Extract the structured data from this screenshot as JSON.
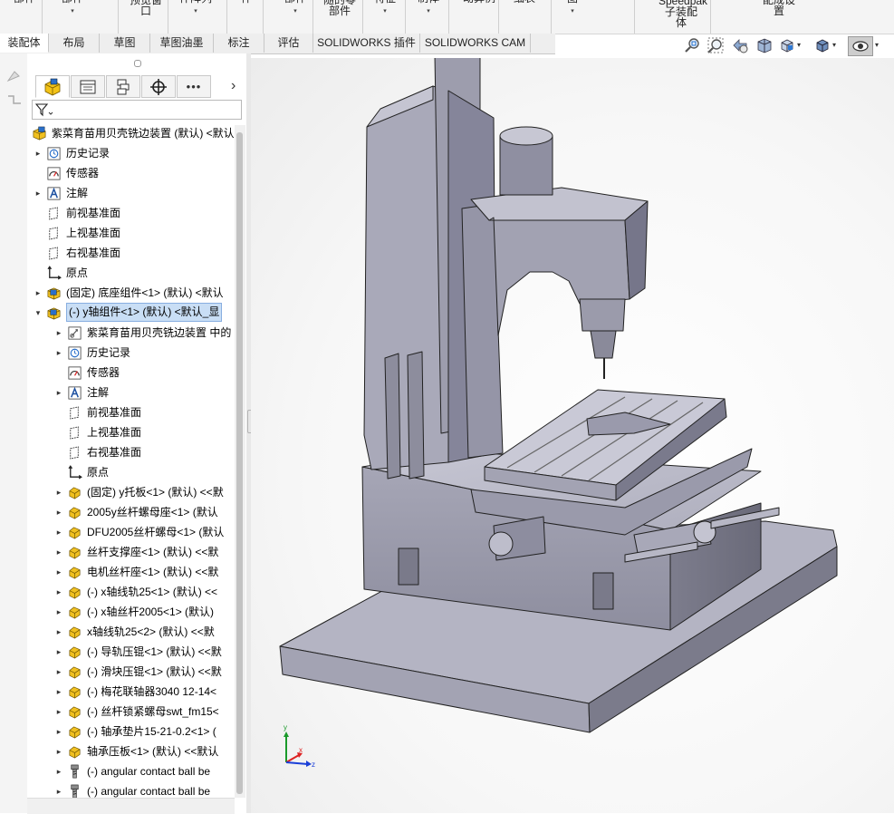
{
  "ribbon": {
    "buttons": [
      {
        "id": "b0",
        "lines": [
          "部件"
        ],
        "has_arrow": false
      },
      {
        "id": "b1",
        "lines": [
          "部件"
        ],
        "has_arrow": true
      },
      {
        "id": "b2",
        "lines": [
          "预览窗",
          "口"
        ],
        "has_arrow": false
      },
      {
        "id": "b3",
        "lines": [
          "件阵列"
        ],
        "has_arrow": true
      },
      {
        "id": "b4",
        "lines": [
          "件"
        ],
        "has_arrow": false
      },
      {
        "id": "b5",
        "lines": [
          "部件"
        ],
        "has_arrow": true
      },
      {
        "id": "b6",
        "lines": [
          "随的零",
          "部件"
        ],
        "has_arrow": false
      },
      {
        "id": "b7",
        "lines": [
          "特征"
        ],
        "has_arrow": true
      },
      {
        "id": "b8",
        "lines": [
          "制体"
        ],
        "has_arrow": true
      },
      {
        "id": "b9",
        "lines": [
          "动算例"
        ],
        "has_arrow": false
      },
      {
        "id": "b10",
        "lines": [
          "细表"
        ],
        "has_arrow": false
      },
      {
        "id": "b11",
        "lines": [
          "图"
        ],
        "has_arrow": true
      },
      {
        "id": "b12",
        "lines": [
          "Speedpak",
          "子装配",
          "体"
        ],
        "has_arrow": false
      },
      {
        "id": "b13",
        "lines": [
          "配成设",
          "置"
        ],
        "has_arrow": false
      }
    ]
  },
  "tabs": [
    "装配体",
    "布局",
    "草图",
    "草图油墨",
    "标注",
    "评估",
    "SOLIDWORKS 插件",
    "SOLIDWORKS CAM"
  ],
  "active_tab": "装配体",
  "view_toolbar": {
    "icons": [
      "zoom-to-fit-icon",
      "zoom-area-icon",
      "previous-view-icon",
      "section-view-icon",
      "view-orientation-icon",
      "display-style-icon",
      "hide-show-items-icon"
    ]
  },
  "feature_tree": {
    "panel_tabs": [
      "feature-manager-tab",
      "property-manager-tab",
      "configuration-manager-tab",
      "dimxpert-manager-tab",
      "more-tabs"
    ],
    "filter_icon": "filter-icon",
    "collapse_arrow": "›",
    "rows": [
      {
        "level": 0,
        "expander": "",
        "icon": "assembly-icon",
        "label": "紫菜育苗用贝壳铣边装置 (默认) <默认"
      },
      {
        "level": 1,
        "expander": "▸",
        "icon": "history-icon",
        "label": "历史记录"
      },
      {
        "level": 1,
        "expander": "",
        "icon": "sensor-icon",
        "label": "传感器"
      },
      {
        "level": 1,
        "expander": "▸",
        "icon": "annotation-icon",
        "label": "注解"
      },
      {
        "level": 1,
        "expander": "",
        "icon": "plane-icon",
        "label": "前视基准面"
      },
      {
        "level": 1,
        "expander": "",
        "icon": "plane-icon",
        "label": "上视基准面"
      },
      {
        "level": 1,
        "expander": "",
        "icon": "plane-icon",
        "label": "右视基准面"
      },
      {
        "level": 1,
        "expander": "",
        "icon": "origin-icon",
        "label": "原点"
      },
      {
        "level": 1,
        "expander": "▸",
        "icon": "subassembly-icon",
        "label": "(固定) 底座组件<1> (默认) <默认"
      },
      {
        "level": 1,
        "expander": "▾",
        "icon": "subassembly-icon",
        "label": "(-) y轴组件<1> (默认) <默认_显",
        "selected": true
      },
      {
        "level": 2,
        "expander": "▸",
        "icon": "reference-icon",
        "label": "紫菜育苗用贝壳铣边装置 中的"
      },
      {
        "level": 2,
        "expander": "▸",
        "icon": "history-icon",
        "label": "历史记录"
      },
      {
        "level": 2,
        "expander": "",
        "icon": "sensor-icon",
        "label": "传感器"
      },
      {
        "level": 2,
        "expander": "▸",
        "icon": "annotation-icon",
        "label": "注解"
      },
      {
        "level": 2,
        "expander": "",
        "icon": "plane-icon",
        "label": "前视基准面"
      },
      {
        "level": 2,
        "expander": "",
        "icon": "plane-icon",
        "label": "上视基准面"
      },
      {
        "level": 2,
        "expander": "",
        "icon": "plane-icon",
        "label": "右视基准面"
      },
      {
        "level": 2,
        "expander": "",
        "icon": "origin-icon",
        "label": "原点"
      },
      {
        "level": 2,
        "expander": "▸",
        "icon": "part-icon",
        "label": "(固定) y托板<1> (默认) <<默"
      },
      {
        "level": 2,
        "expander": "▸",
        "icon": "part-icon",
        "label": "2005y丝杆螺母座<1> (默认"
      },
      {
        "level": 2,
        "expander": "▸",
        "icon": "part-icon",
        "label": "DFU2005丝杆螺母<1> (默认"
      },
      {
        "level": 2,
        "expander": "▸",
        "icon": "part-icon",
        "label": "丝杆支撑座<1> (默认) <<默"
      },
      {
        "level": 2,
        "expander": "▸",
        "icon": "part-icon",
        "label": "电机丝杆座<1> (默认) <<默"
      },
      {
        "level": 2,
        "expander": "▸",
        "icon": "part-icon",
        "label": "(-) x轴线轨25<1> (默认) <<"
      },
      {
        "level": 2,
        "expander": "▸",
        "icon": "part-icon",
        "label": "(-) x轴丝杆2005<1> (默认)"
      },
      {
        "level": 2,
        "expander": "▸",
        "icon": "part-icon",
        "label": "x轴线轨25<2> (默认) <<默"
      },
      {
        "level": 2,
        "expander": "▸",
        "icon": "part-icon",
        "label": "(-) 导轨压锟<1> (默认) <<默"
      },
      {
        "level": 2,
        "expander": "▸",
        "icon": "part-icon",
        "label": "(-) 滑块压锟<1> (默认) <<默"
      },
      {
        "level": 2,
        "expander": "▸",
        "icon": "part-icon",
        "label": "(-) 梅花联轴器3040 12-14<"
      },
      {
        "level": 2,
        "expander": "▸",
        "icon": "part-icon",
        "label": "(-) 丝杆锁紧螺母swt_fm15<"
      },
      {
        "level": 2,
        "expander": "▸",
        "icon": "part-icon",
        "label": "(-) 轴承垫片15-21-0.2<1> ("
      },
      {
        "level": 2,
        "expander": "▸",
        "icon": "part-icon",
        "label": "轴承压板<1> (默认) <<默认"
      },
      {
        "level": 2,
        "expander": "▸",
        "icon": "toolbox-part-icon",
        "label": "(-) angular contact ball be"
      },
      {
        "level": 2,
        "expander": "▸",
        "icon": "toolbox-part-icon",
        "label": "(-) angular contact ball be"
      }
    ]
  },
  "triad": {
    "x": "x",
    "y": "y",
    "z": "z"
  },
  "colors": {
    "model": "#9a9aab",
    "model_light": "#b9b9c8",
    "model_dark": "#70707f",
    "part_icon": "#f0c020",
    "assembly_icon_blue": "#2a6fc9",
    "selection": "#c9def5"
  }
}
